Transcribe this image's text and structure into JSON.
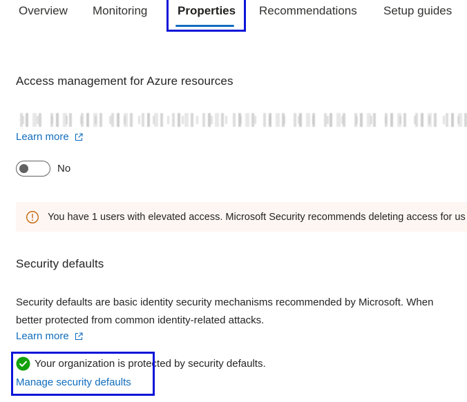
{
  "tabs": [
    {
      "label": "Overview"
    },
    {
      "label": "Monitoring"
    },
    {
      "label": "Properties"
    },
    {
      "label": "Recommendations"
    },
    {
      "label": "Setup guides"
    }
  ],
  "active_tab": "Properties",
  "access": {
    "heading": "Access management for Azure resources",
    "learn_more": "Learn more",
    "toggle_value": "No",
    "banner_text": "You have 1 users with elevated access. Microsoft Security recommends deleting access for us"
  },
  "security_defaults": {
    "heading": "Security defaults",
    "line1": "Security defaults are basic identity security mechanisms recommended by Microsoft. When",
    "line2": "better protected from common identity-related attacks.",
    "learn_more": "Learn more",
    "status_text": "Your organization is protected by security defaults.",
    "manage_link": "Manage security defaults"
  },
  "colors": {
    "accent": "#0f6cbd",
    "highlight_box": "#0a15d8",
    "warning_bg": "#fdf6f3",
    "warning_icon": "#c25e00",
    "success": "#13a10e"
  }
}
